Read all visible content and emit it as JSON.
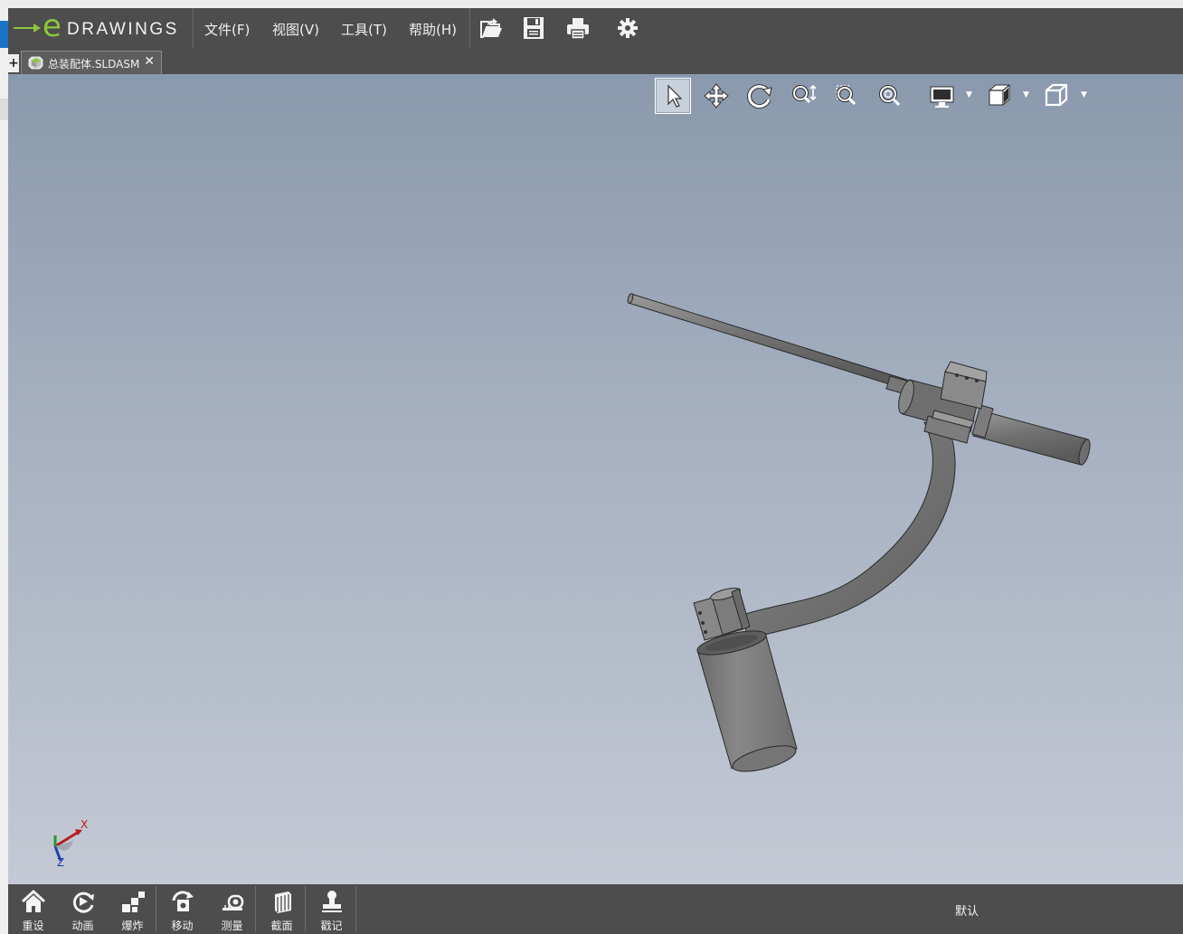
{
  "app": {
    "logo_letter": "e",
    "logo_word": "DRAWINGS"
  },
  "menu": {
    "items": [
      "文件(F)",
      "视图(V)",
      "工具(T)",
      "帮助(H)"
    ]
  },
  "toolbar": {
    "icons": [
      "open-icon",
      "save-icon",
      "print-icon",
      "settings-icon"
    ]
  },
  "tabs": [
    {
      "label": "总装配体.SLDASM",
      "close": "✕"
    }
  ],
  "tab_add": "+",
  "view_toolbar": {
    "active_tool": "select",
    "icons": [
      "select-arrow-icon",
      "pan-icon",
      "rotate-icon",
      "zoom-icon",
      "zoom-window-icon",
      "zoom-fit-icon",
      "display-style-icon",
      "shading-icon",
      "view-orientation-icon"
    ]
  },
  "triad": {
    "x": "X",
    "z": "Z"
  },
  "bottom_toolbar": {
    "buttons": [
      "重设",
      "动画",
      "爆炸",
      "移动",
      "测量",
      "截面",
      "戳记"
    ]
  },
  "status": {
    "configuration": "默认"
  },
  "colors": {
    "chrome": "#4d4d4d",
    "logo_accent": "#8cc63f",
    "model": "#7a7a7a"
  }
}
